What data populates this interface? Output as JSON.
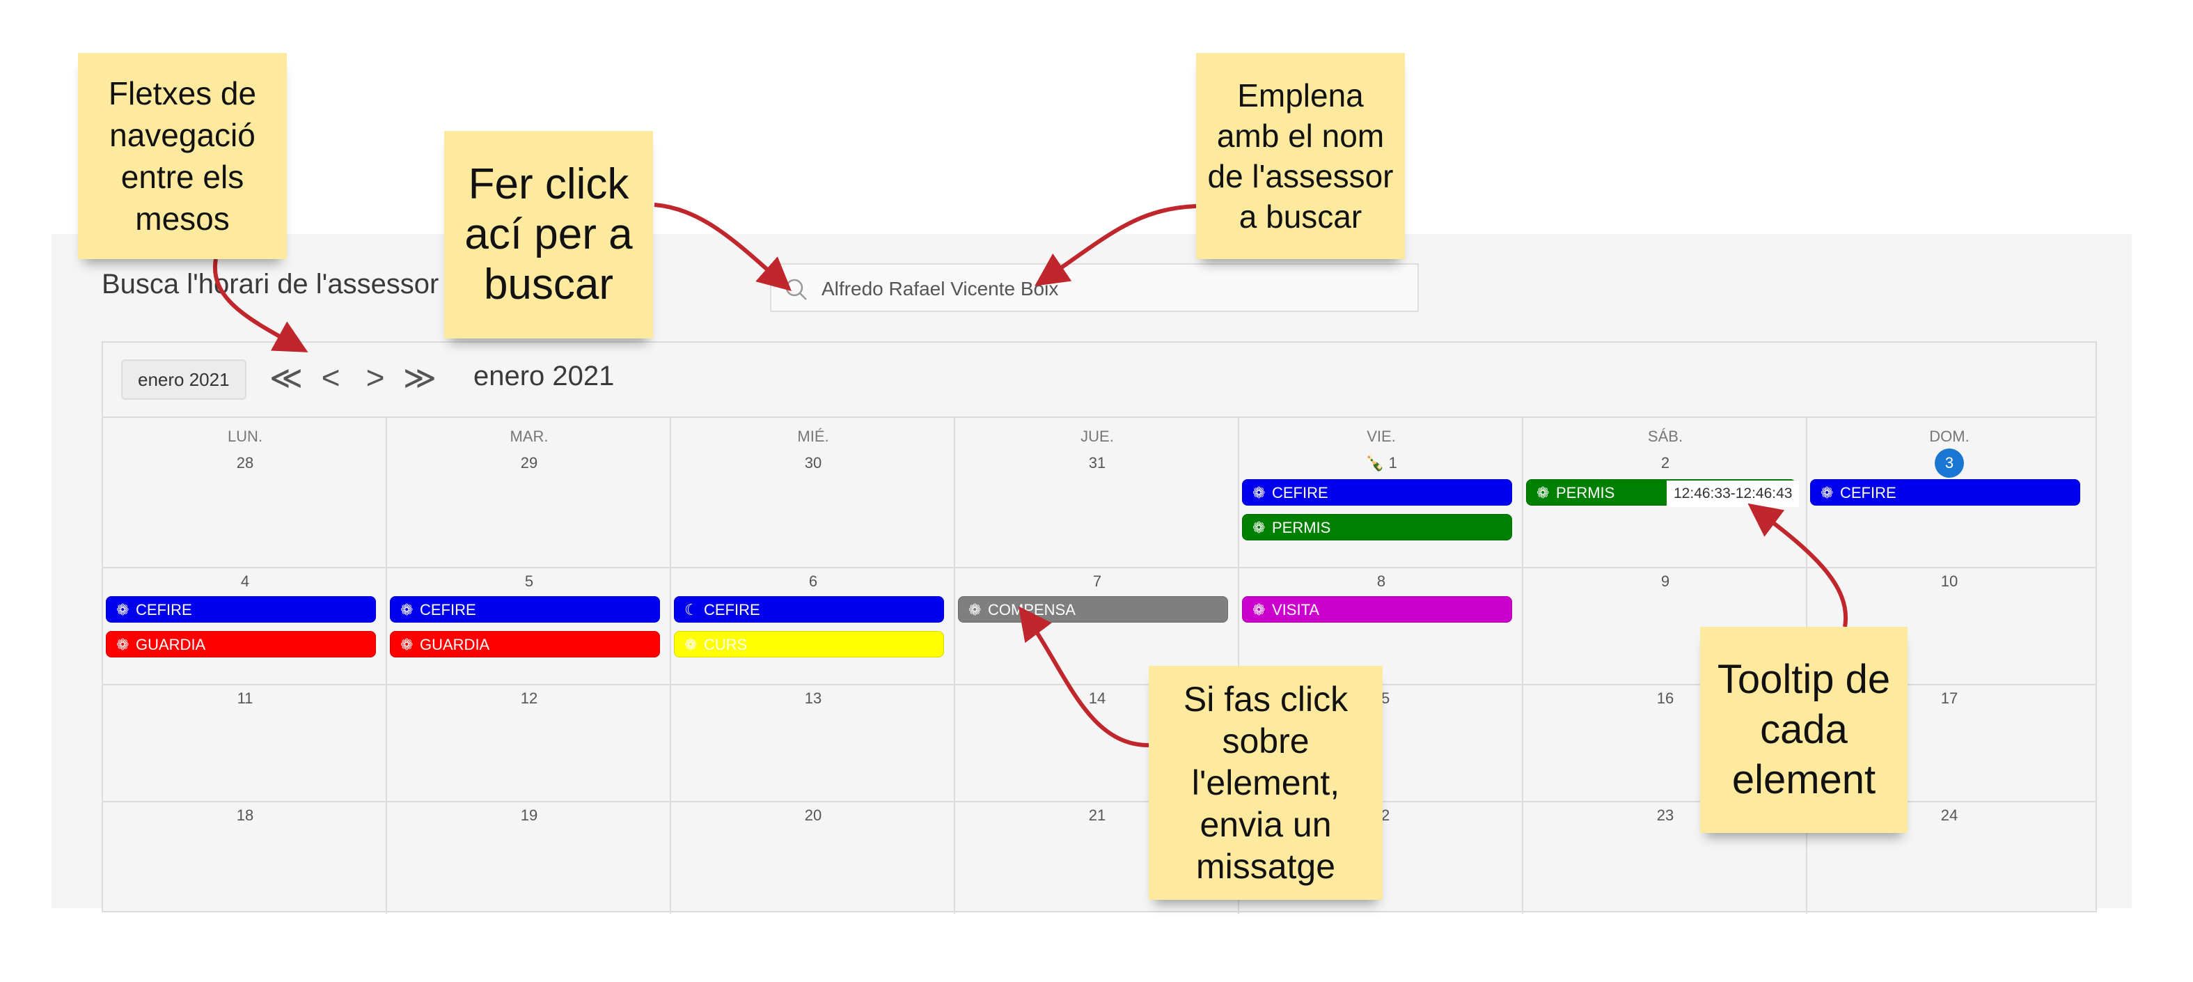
{
  "page": {
    "title": "Busca l'horari de l'assessor"
  },
  "search": {
    "value": "Alfredo Rafael Vicente Boix",
    "icon": "search-icon"
  },
  "calendar": {
    "month_button": "enero 2021",
    "nav": {
      "first": "≪",
      "prev": "<",
      "next": ">",
      "last": "≫"
    },
    "month_title": "enero 2021",
    "weekdays": [
      "LUN.",
      "MAR.",
      "MIÉ.",
      "JUE.",
      "VIE.",
      "SÁB.",
      "DOM."
    ],
    "weeks": [
      [
        "28",
        "29",
        "30",
        "31",
        "1",
        "2",
        "3"
      ],
      [
        "4",
        "5",
        "6",
        "7",
        "8",
        "9",
        "10"
      ],
      [
        "11",
        "12",
        "13",
        "14",
        "15",
        "16",
        "17"
      ],
      [
        "18",
        "19",
        "20",
        "21",
        "22",
        "23",
        "24"
      ]
    ],
    "events": {
      "vie1_cefire": "CEFIRE",
      "vie1_permis": "PERMIS",
      "sab2_permis": "PERMIS",
      "dom3_cefire": "CEFIRE",
      "lun4_cefire": "CEFIRE",
      "lun4_guardia": "GUARDIA",
      "mar5_cefire": "CEFIRE",
      "mar5_guardia": "GUARDIA",
      "mie6_cefire": "CEFIRE",
      "mie6_curs": "CURS",
      "jue7_compensa": "COMPENSA",
      "vie8_visita": "VISITA"
    },
    "tooltip": "12:46:33-12:46:43",
    "colors": {
      "blue": "#0000ee",
      "green": "#008000",
      "red": "#ff0000",
      "yellow": "#ffff00",
      "gray": "#7f7f7f",
      "magenta": "#cc00cc",
      "today": "#1976d2"
    }
  },
  "notes": {
    "nav": "Fletxes de\nnavegació\nentre els\nmesos",
    "search_btn": "Fer click\nací per a\nbuscar",
    "fill": "Emplena\namb el nom\nde l'assessor\na buscar",
    "click": "Si fas click\nsobre\nl'element,\nenvia un\nmissatge",
    "tooltip": "Tooltip de\ncada\nelement"
  }
}
